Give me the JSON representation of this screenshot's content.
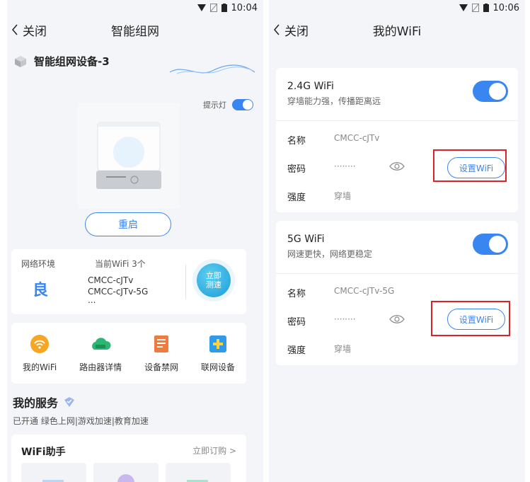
{
  "left": {
    "status": {
      "time": "10:04"
    },
    "topbar": {
      "back_label": "关闭",
      "title": "智能组网"
    },
    "device": {
      "name": "智能组网设备-3",
      "lamp_label": "提示灯",
      "restart_label": "重启"
    },
    "network": {
      "env_label": "网络环境",
      "env_value": "良",
      "wifi_count_label": "当前WiFi 3个",
      "wifi_list": [
        "CMCC-cJTv",
        "CMCC-cJTv-5G",
        "..."
      ],
      "speed_test_label": "立即\n测速"
    },
    "quick_actions": [
      {
        "label": "我的WiFi",
        "icon": "wifi-icon"
      },
      {
        "label": "路由器详情",
        "icon": "router-cloud-icon"
      },
      {
        "label": "设备禁网",
        "icon": "device-block-icon"
      },
      {
        "label": "联网设备",
        "icon": "add-device-icon"
      }
    ],
    "services": {
      "title": "我的服务",
      "subtitle": "已开通  绿色上网|游戏加速|教育加速"
    },
    "assistant": {
      "title": "WiFi助手",
      "buy_label": "立即订购 >"
    }
  },
  "right": {
    "status": {
      "time": "10:06"
    },
    "topbar": {
      "back_label": "关闭",
      "title": "我的WiFi"
    },
    "networks": [
      {
        "band": "2.4G WiFi",
        "desc": "穿墙能力强，传播距离远",
        "enabled": true,
        "name_label": "名称",
        "name_value": "CMCC-cJTv",
        "pwd_label": "密码",
        "pwd_value": "········",
        "strength_label": "强度",
        "strength_value": "穿墙",
        "set_label": "设置WiFi"
      },
      {
        "band": "5G WiFi",
        "desc": "网速更快，网络更稳定",
        "enabled": true,
        "name_label": "名称",
        "name_value": "CMCC-cJTv-5G",
        "pwd_label": "密码",
        "pwd_value": "········",
        "strength_label": "强度",
        "strength_value": "穿墙",
        "set_label": "设置WiFi"
      }
    ]
  },
  "colors": {
    "accent": "#3a86f0",
    "highlight": "#d8232a",
    "background": "#f4f5f8"
  }
}
